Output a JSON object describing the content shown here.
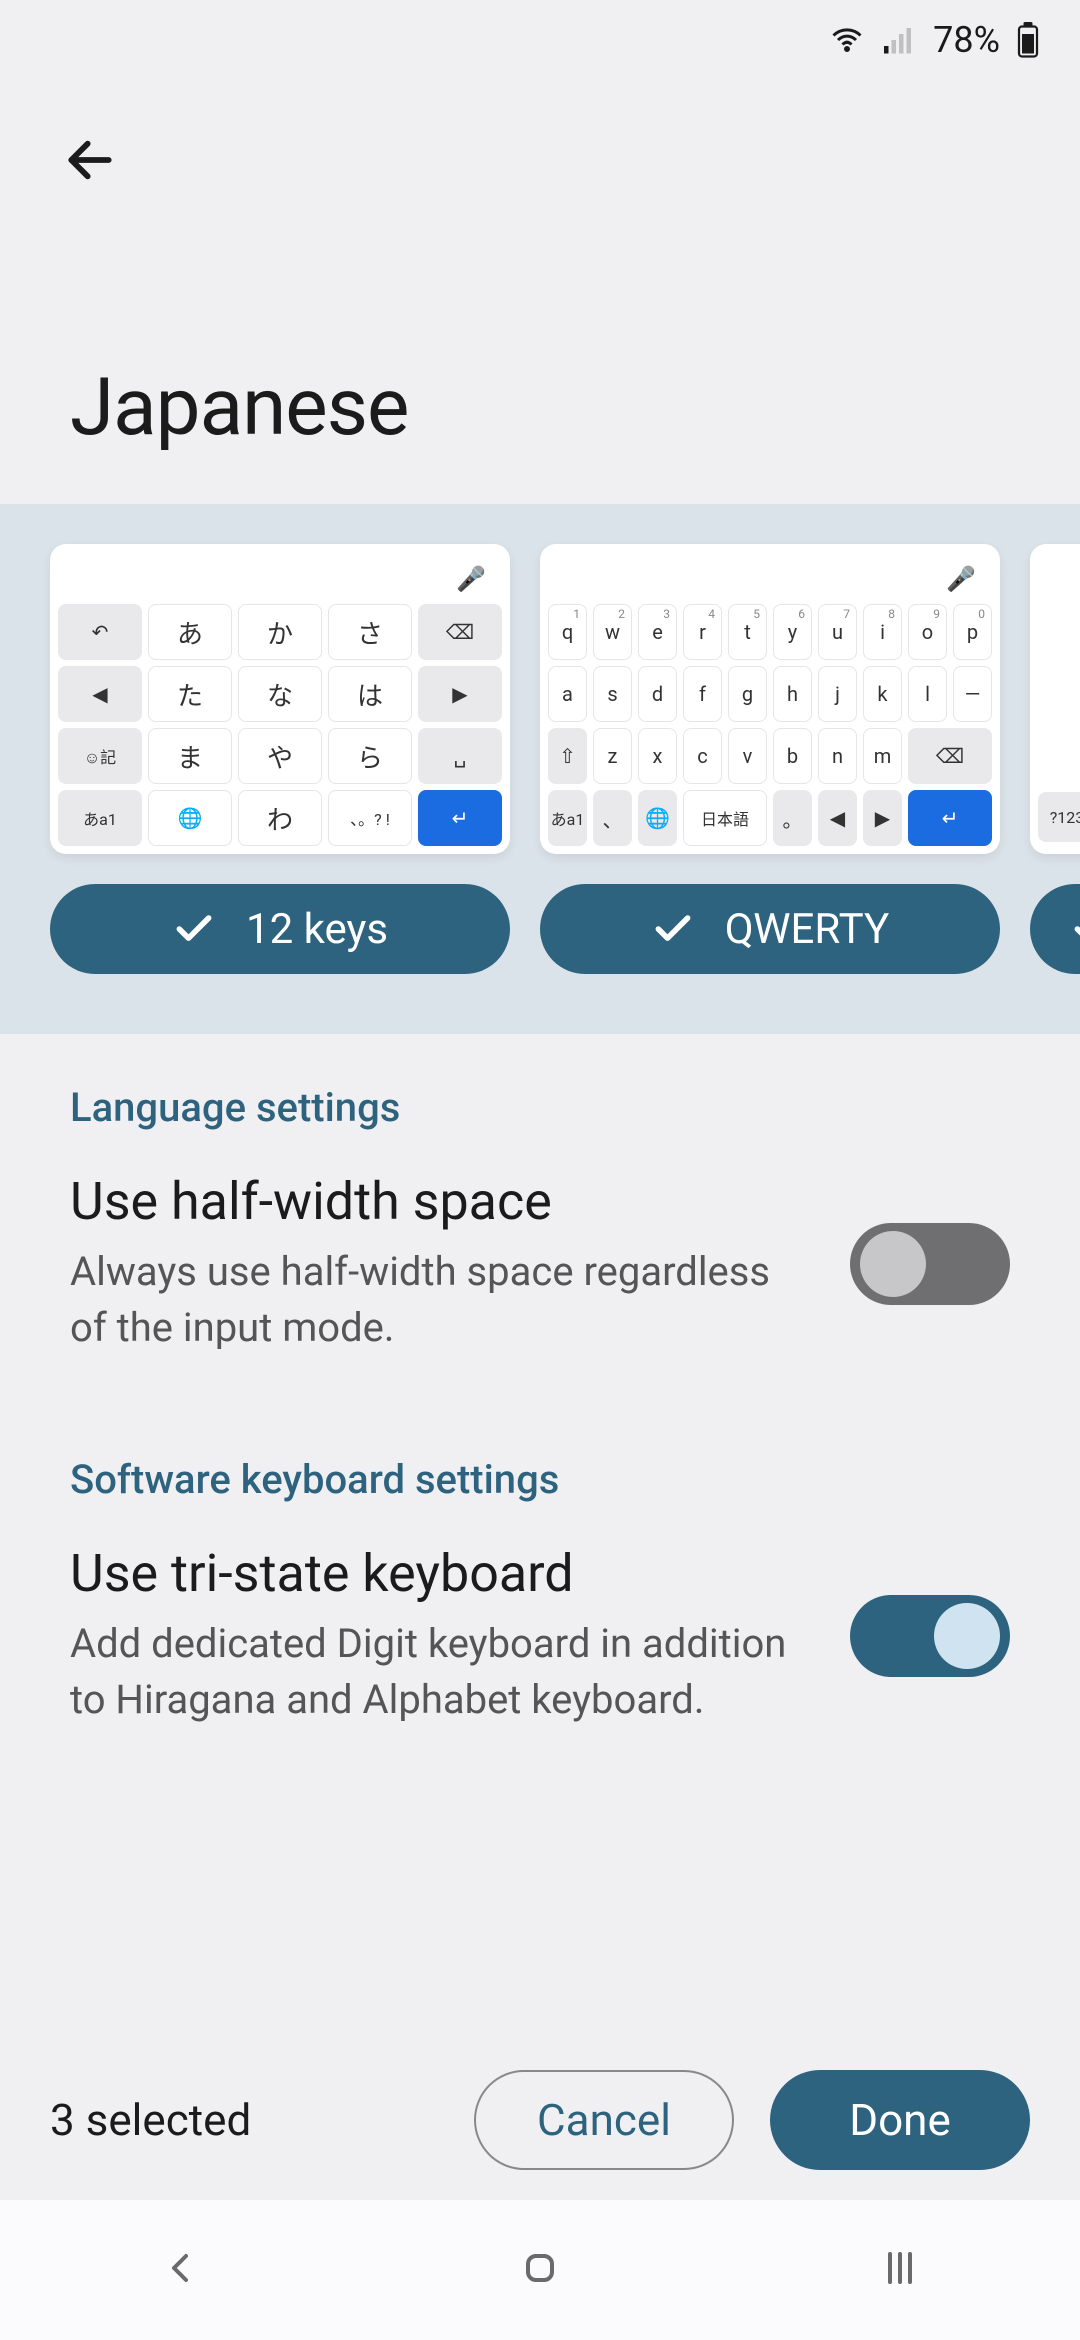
{
  "status": {
    "battery": "78%"
  },
  "title": "Japanese",
  "layouts": [
    {
      "name": "12 keys",
      "keys_row1": [
        "あ",
        "か",
        "さ"
      ],
      "keys_row2": [
        "た",
        "な",
        "は"
      ],
      "keys_row3": [
        "ま",
        "や",
        "ら"
      ],
      "keys_row4_center": "わ",
      "mode_key": "あa1"
    },
    {
      "name": "QWERTY",
      "row1": [
        "q",
        "w",
        "e",
        "r",
        "t",
        "y",
        "u",
        "i",
        "o",
        "p"
      ],
      "row1_sup": [
        "1",
        "2",
        "3",
        "4",
        "5",
        "6",
        "7",
        "8",
        "9",
        "0"
      ],
      "row2": [
        "a",
        "s",
        "d",
        "f",
        "g",
        "h",
        "j",
        "k",
        "l",
        "—"
      ],
      "row3": [
        "z",
        "x",
        "c",
        "v",
        "b",
        "n",
        "m"
      ],
      "mode_key": "あa1",
      "lang_key": "日本語"
    },
    {
      "name_partial": "",
      "mode_key": "?123"
    }
  ],
  "sections": {
    "lang": {
      "header": "Language settings",
      "halfwidth": {
        "label": "Use half-width space",
        "desc": "Always use half-width space regardless of the input mode.",
        "on": false
      }
    },
    "soft": {
      "header": "Software keyboard settings",
      "tristate": {
        "label": "Use tri-state keyboard",
        "desc": "Add dedicated Digit keyboard in addition to Hiragana and Alphabet keyboard.",
        "on": true
      }
    }
  },
  "footer": {
    "count": "3 selected",
    "cancel": "Cancel",
    "done": "Done"
  }
}
